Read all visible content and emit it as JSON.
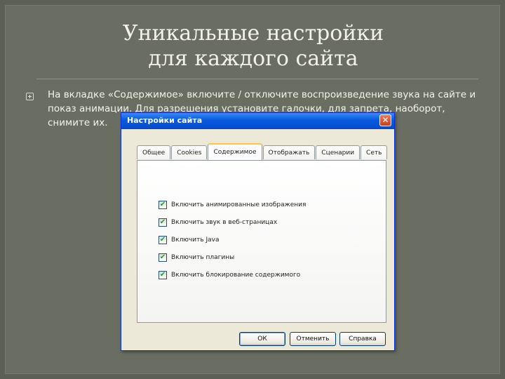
{
  "slide": {
    "title_line1": "Уникальные настройки",
    "title_line2": "для каждого сайта",
    "bullet_text": "На вкладке «Содержимое» включите / отключите воспроизведение звука на сайте и показ анимации. Для разрешения установите галочки, для запрета, наоборот, снимите их."
  },
  "dialog": {
    "title": "Настройки сайта",
    "close_symbol": "✕",
    "tabs": [
      {
        "label": "Общее"
      },
      {
        "label": "Cookies"
      },
      {
        "label": "Содержимое",
        "active": true
      },
      {
        "label": "Отображать"
      },
      {
        "label": "Сценарии"
      },
      {
        "label": "Сеть"
      }
    ],
    "checkboxes": [
      {
        "label": "Включить анимированные изображения",
        "checked": true
      },
      {
        "label": "Включить звук в веб-страницах",
        "checked": true
      },
      {
        "label": "Включить Java",
        "checked": true
      },
      {
        "label": "Включить плагины",
        "checked": true
      },
      {
        "label": "Включить блокирование содержимого",
        "checked": true
      }
    ],
    "buttons": {
      "ok": "ОК",
      "cancel": "Отменить",
      "help": "Справка"
    }
  }
}
